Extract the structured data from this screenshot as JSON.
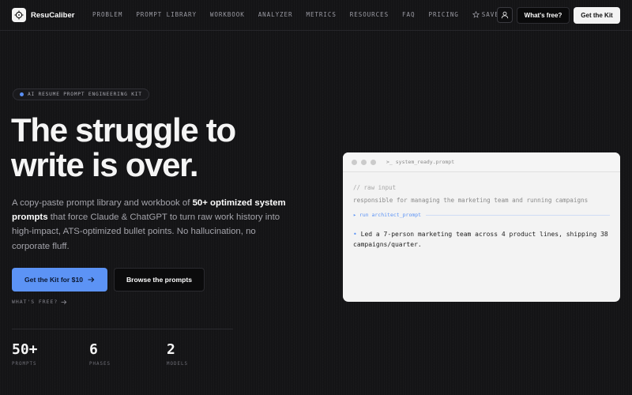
{
  "brand": {
    "name": "ResuCaliber",
    "icon": "crosshair-icon"
  },
  "nav": {
    "links": [
      "PROBLEM",
      "PROMPT LIBRARY",
      "WORKBOOK",
      "ANALYZER",
      "METRICS",
      "RESOURCES",
      "FAQ",
      "PRICING"
    ],
    "saved_label": "SAVED",
    "whats_free_label": "What's free?",
    "get_kit_label": "Get the Kit"
  },
  "hero": {
    "badge": "AI RESUME PROMPT ENGINEERING KIT",
    "headline_line1": "The struggle to",
    "headline_line2": "write is over.",
    "lede_part1": "A copy-paste prompt library and workbook of ",
    "lede_bold": "50+ optimized system prompts",
    "lede_part2": " that force Claude & ChatGPT to turn raw work history into high-impact, ATS-optimized bullet points. No hallucination, no corporate fluff.",
    "cta_primary": "Get the Kit for $10",
    "cta_secondary": "Browse the prompts",
    "whats_free_link": "WHAT'S FREE?"
  },
  "stats": [
    {
      "value": "50+",
      "label": "PROMPTS"
    },
    {
      "value": "6",
      "label": "PHASES"
    },
    {
      "value": "2",
      "label": "MODELS"
    }
  ],
  "editor": {
    "filename": "system_ready.prompt",
    "raw_label": "// raw input",
    "raw_text": "responsible for managing the marketing team and running campaigns",
    "run_label": "▸ run architect_prompt",
    "output_bullet": "•",
    "output_text": "Led a 7-person marketing team across 4 product lines, shipping 38 campaigns/quarter."
  },
  "colors": {
    "accent": "#5c93f5",
    "background": "#141416",
    "card": "#f3f3f3"
  }
}
